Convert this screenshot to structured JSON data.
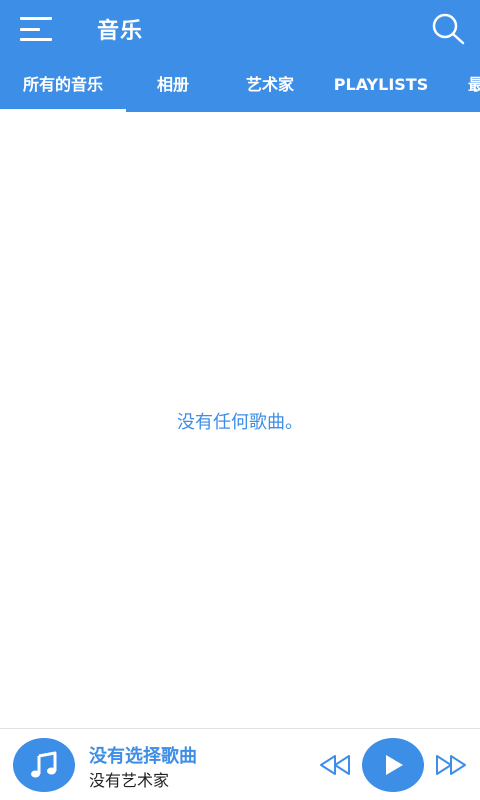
{
  "appbar": {
    "title": "音乐",
    "menu_icon": "menu-icon",
    "search_icon": "search-icon"
  },
  "tabs": [
    {
      "label": "所有的音乐",
      "active": true
    },
    {
      "label": "相册",
      "active": false
    },
    {
      "label": "艺术家",
      "active": false
    },
    {
      "label": "PLAYLISTS",
      "active": false
    },
    {
      "label": "最",
      "active": false
    }
  ],
  "content": {
    "empty_message": "没有任何歌曲。"
  },
  "player": {
    "song_title": "没有选择歌曲",
    "artist": "没有艺术家",
    "art_icon": "music-note-icon",
    "prev_icon": "rewind-icon",
    "play_icon": "play-icon",
    "next_icon": "fast-forward-icon"
  },
  "colors": {
    "primary": "#3d8ee6",
    "background": "#ffffff",
    "text_dark": "#222222"
  }
}
